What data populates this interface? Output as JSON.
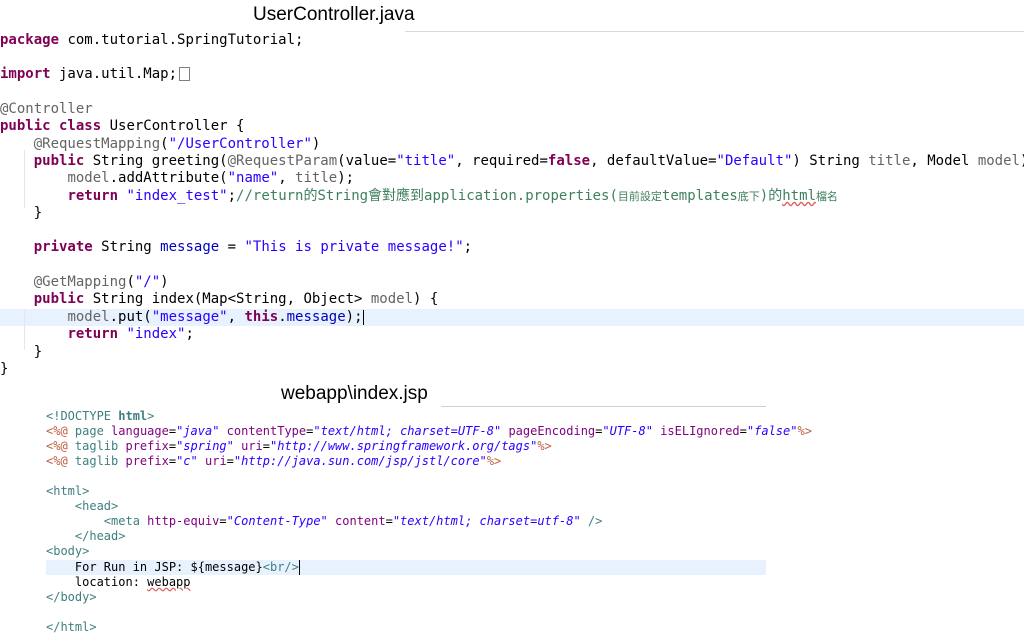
{
  "java_title": "UserController.java",
  "jsp_title": "webapp\\index.jsp",
  "java_code": {
    "l1": {
      "kw": "package",
      "rest": " com.tutorial.SpringTutorial;"
    },
    "l2": {
      "kw": "import",
      "rest": " java.util.Map;"
    },
    "l3": {
      "ann": "@Controller"
    },
    "l4": {
      "kw": "public class",
      "rest": " UserController {"
    },
    "l5": {
      "ann": "@RequestMapping",
      "p1": "(",
      "str": "\"/UserController\"",
      "p2": ")"
    },
    "l6": {
      "kw": "public",
      "t1": " String greeting(",
      "ann": "@RequestParam",
      "t2": "(value=",
      "s1": "\"title\"",
      "t3": ", required=",
      "kw2": "false",
      "t4": ", defaultValue=",
      "s2": "\"Default\"",
      "t5": ") String ",
      "v1": "title",
      "t6": ", Model ",
      "v2": "model",
      "t7": ") {"
    },
    "l7": {
      "v": "model",
      "t1": ".addAttribute(",
      "s1": "\"name\"",
      "t2": ", ",
      "v2": "title",
      "t3": ");"
    },
    "l8": {
      "kw": "return",
      "sp": " ",
      "s1": "\"index_test\"",
      "t1": ";",
      "c1": "//return的String會對應到application.properties(",
      "c2": "目前設定",
      "c3": "templates",
      "c4": "底下",
      "c5": ")的",
      "c6": "html",
      "c7": "檔名"
    },
    "l9": {
      "t": "}"
    },
    "l10": {
      "kw": "private",
      "t1": " String ",
      "f": "message",
      "t2": " = ",
      "s": "\"This is private message!\"",
      "t3": ";"
    },
    "l11": {
      "ann": "@GetMapping",
      "p1": "(",
      "s": "\"/\"",
      "p2": ")"
    },
    "l12": {
      "kw": "public",
      "t1": " String index(Map<String, Object> ",
      "v": "model",
      "t2": ") {"
    },
    "l13": {
      "v": "model",
      "t1": ".put(",
      "s": "\"message\"",
      "t2": ", ",
      "kw": "this",
      "t3": ".",
      "f": "message",
      "t4": ");"
    },
    "l14": {
      "kw": "return",
      "sp": " ",
      "s": "\"index\"",
      "t": ";"
    },
    "l15": {
      "t": "}"
    },
    "l16": {
      "t": "}"
    }
  },
  "jsp_code": {
    "l1": {
      "a": "<!DOCTYPE ",
      "b": "html",
      "c": ">"
    },
    "l2": {
      "d1": "<%@",
      "t1": " page ",
      "a1": "language",
      "e1": "=",
      "v1": "\"java\"",
      "a2": " contentType",
      "e2": "=",
      "v2": "\"text/html; charset=UTF-8\"",
      "a3": " pageEncoding",
      "e3": "=",
      "v3": "\"UTF-8\"",
      "a4": " isELIgnored",
      "e4": "=",
      "v4": "\"false\"",
      "d2": "%>"
    },
    "l3": {
      "d1": "<%@",
      "t1": " taglib ",
      "a1": "prefix",
      "e1": "=",
      "v1": "\"spring\"",
      "a2": " uri",
      "e2": "=",
      "v2": "\"http://www.springframework.org/tags\"",
      "d2": "%>"
    },
    "l4": {
      "d1": "<%@",
      "t1": " taglib ",
      "a1": "prefix",
      "e1": "=",
      "v1": "\"c\"",
      "a2": " uri",
      "e2": "=",
      "v2": "\"http://java.sun.com/jsp/jstl/core\"",
      "d2": "%>"
    },
    "l5": {
      "t": "<html>"
    },
    "l6": {
      "t": "<head>"
    },
    "l7": {
      "t1": "<meta ",
      "a1": "http-equiv",
      "e1": "=",
      "v1": "\"Content-Type\"",
      "a2": " content",
      "e2": "=",
      "v2": "\"text/html; charset=utf-8\"",
      "t2": " />"
    },
    "l8": {
      "t": "</head>"
    },
    "l9": {
      "t": "<body>"
    },
    "l10": {
      "x": "For Run in JSP: ${message}",
      "t": "<br/>"
    },
    "l11": {
      "x1": "location: ",
      "x2": "webapp"
    },
    "l12": {
      "t": "</body>"
    },
    "l13": {
      "t": "</html>"
    }
  }
}
